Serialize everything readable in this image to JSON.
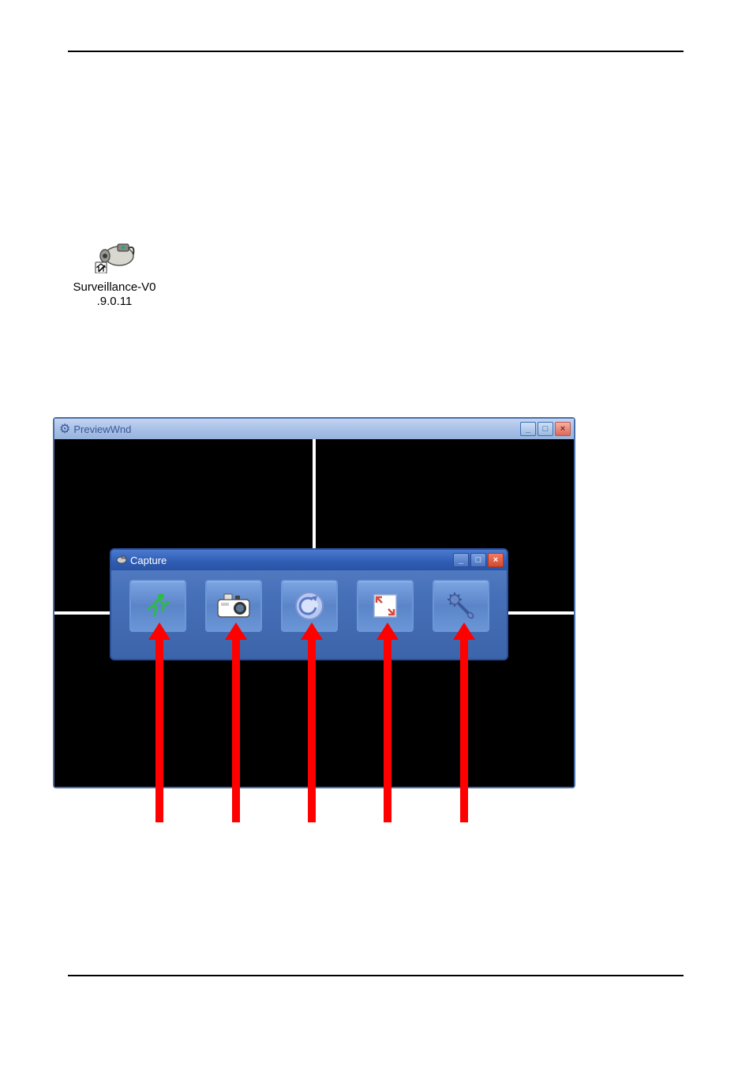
{
  "shortcut": {
    "label_line1": "Surveillance-V0",
    "label_line2": ".9.0.11"
  },
  "preview_window": {
    "title": "PreviewWnd",
    "controls": {
      "minimize": "_",
      "maximize": "□",
      "close": "×"
    }
  },
  "capture_window": {
    "title": "Capture",
    "controls": {
      "minimize": "_",
      "maximize": "□",
      "close": "×"
    },
    "buttons": [
      {
        "name": "motion-detect"
      },
      {
        "name": "snapshot"
      },
      {
        "name": "playback"
      },
      {
        "name": "fullscreen"
      },
      {
        "name": "settings"
      }
    ]
  }
}
